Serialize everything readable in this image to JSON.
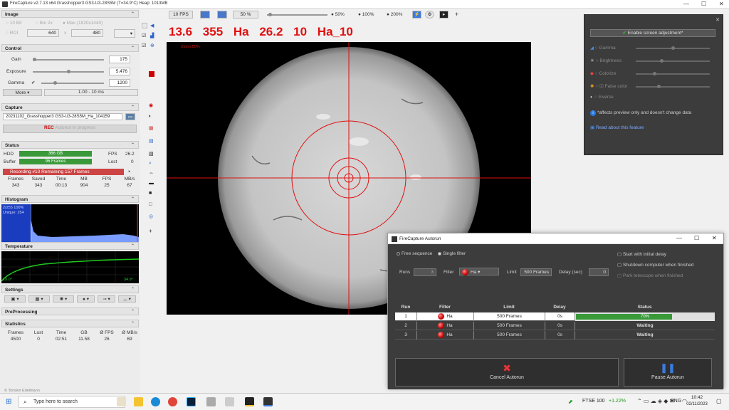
{
  "window": {
    "title": "FireCapture v2.7.13 x64    Grasshopper3 GS3-U3-28S5M (T=34.9°C)    Heap: 1013MB"
  },
  "toolbar": {
    "fps": "10 FPS",
    "zoom": "50 %",
    "z50": "50%",
    "z100": "100%",
    "z200": "200%",
    "plus": "+"
  },
  "overlay": {
    "text": "13.6  355  Ha  26.2  10  Ha_10"
  },
  "preview": {
    "zoom_label": "Zoom 50%"
  },
  "image": {
    "header": "Image",
    "bin1": "10 Bit",
    "bin2": "Bin 2x",
    "max": "Max (1920x1440)",
    "roi": "ROI",
    "w": "640",
    "x": "x",
    "h": "480"
  },
  "control": {
    "header": "Control",
    "gain_label": "Gain",
    "gain_value": "175",
    "exposure_label": "Exposure",
    "exposure_value": "5.476",
    "gamma_label": "Gamma",
    "gamma_value": "1200",
    "more": "More",
    "range": "1.00 - 10 ms"
  },
  "capture": {
    "header": "Capture",
    "filename": "20231102_Grasshopper3 GS3-U3-28S5M_Ha_104159",
    "rec": "REC",
    "autorun": "Autorun in progress"
  },
  "status": {
    "header": "Status",
    "hdd_label": "HDD",
    "hdd_value": "366 GB",
    "fps_label": "FPS",
    "fps_value": "26.2",
    "buffer_label": "Buffer",
    "buffer_value": "96 Frames",
    "lost_label": "Lost",
    "lost_value": "0",
    "recording": "Recording #10  Remaining  157 Frames",
    "cols": [
      "Frames",
      "Saved",
      "Time",
      "MB",
      "FPS",
      "MB/s"
    ],
    "vals": [
      "343",
      "343",
      "00:13",
      "904",
      "25",
      "67"
    ]
  },
  "histogram": {
    "header": "Histogram",
    "info1": "2/255 100%",
    "info2": "Unique: 254"
  },
  "temperature": {
    "header": "Temperature",
    "low": "19.0°",
    "high": "34.9°"
  },
  "settings": {
    "header": "Settings"
  },
  "preprocessing": {
    "header": "PreProcessing"
  },
  "statistics": {
    "header": "Statistics",
    "cols": [
      "Frames",
      "Lost",
      "Time",
      "GB",
      "Ø FPS",
      "Ø MB/s"
    ],
    "vals": [
      "4500",
      "0",
      "02:51",
      "11.58",
      "26",
      "69"
    ]
  },
  "copyright": "© Torsten Edelmann",
  "right_panel": {
    "enable": "Enable screen adjustment*",
    "gamma": "Gamma",
    "brightness": "Brightness",
    "colorize": "Colorize",
    "false_color": "False color",
    "inverse": "Inverse",
    "note": "*affects preview only and doesn't change data",
    "link": "Read about this feature"
  },
  "autorun": {
    "title": "FireCapture Autorun",
    "free_seq": "Free sequence",
    "single_filter": "Single filter",
    "start_delay": "Start with initial delay",
    "shutdown": "Shutdown computer when finished",
    "park": "Park telescope when finished",
    "runs_label": "Runs",
    "runs_value": "3",
    "filter_label": "Filter",
    "filter_value": "Ha",
    "limit_label": "Limit",
    "limit_value": "500 Frames",
    "delay_label": "Delay (sec)",
    "delay_value": "0",
    "headers": [
      "Run",
      "Filter",
      "Limit",
      "Delay",
      "Status"
    ],
    "rows": [
      {
        "run": "1",
        "filter": "Ha",
        "limit": "500 Frames",
        "delay": "0s",
        "status": "70%",
        "progress": 0.7
      },
      {
        "run": "2",
        "filter": "Ha",
        "limit": "500 Frames",
        "delay": "0s",
        "status": "Waiting"
      },
      {
        "run": "3",
        "filter": "Ha",
        "limit": "500 Frames",
        "delay": "0s",
        "status": "Waiting"
      }
    ],
    "cancel": "Cancel Autorun",
    "pause": "Pause Autorun"
  },
  "taskbar": {
    "search": "Type here to search",
    "ftse": "FTSE 100",
    "ftse_change": "+1.22%",
    "lang": "ENG",
    "time": "10:42",
    "date": "02/11/2023"
  }
}
